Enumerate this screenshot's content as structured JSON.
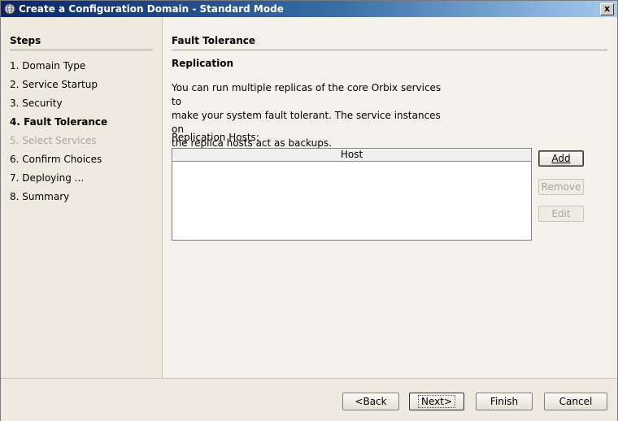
{
  "window": {
    "title": "Create a Configuration Domain - Standard Mode",
    "close_label": "x"
  },
  "steps": {
    "heading": "Steps",
    "items": [
      {
        "label": "1. Domain Type",
        "state": "normal"
      },
      {
        "label": "2. Service Startup",
        "state": "normal"
      },
      {
        "label": "3. Security",
        "state": "normal"
      },
      {
        "label": "4. Fault Tolerance",
        "state": "current"
      },
      {
        "label": "5. Select Services",
        "state": "disabled"
      },
      {
        "label": "6. Confirm Choices",
        "state": "normal"
      },
      {
        "label": "7. Deploying ...",
        "state": "normal"
      },
      {
        "label": "8. Summary",
        "state": "normal"
      }
    ]
  },
  "main": {
    "section_title": "Fault Tolerance",
    "subsection_title": "Replication",
    "description_lines": [
      "You can run multiple replicas of the core Orbix services to",
      "make your system fault tolerant. The service instances on",
      "the replica hosts act as backups."
    ],
    "hosts_label": "Replication Hosts:",
    "table": {
      "columns": [
        "Host"
      ],
      "rows": []
    },
    "buttons": {
      "add": "Add",
      "remove": "Remove",
      "edit": "Edit"
    }
  },
  "footer": {
    "back": "<Back",
    "next": "Next>",
    "finish": "Finish",
    "cancel": "Cancel"
  }
}
